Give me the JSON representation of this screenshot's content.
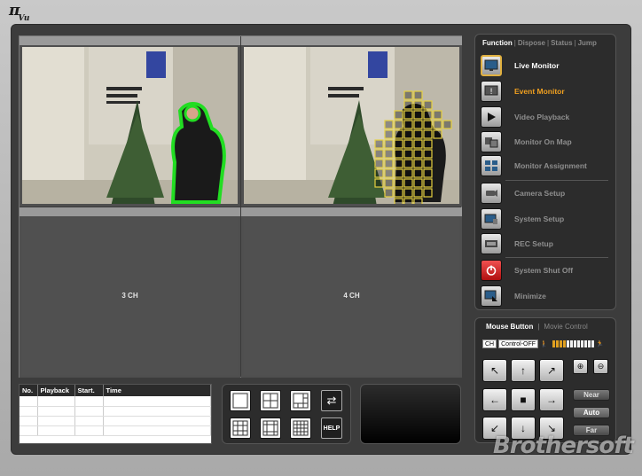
{
  "app": {
    "logo_text": "π",
    "logo_sub": "Vu"
  },
  "channels": [
    {
      "id": 1,
      "label": "",
      "has_feed": true
    },
    {
      "id": 2,
      "label": "",
      "has_feed": true
    },
    {
      "id": 3,
      "label": "3 CH",
      "has_feed": false
    },
    {
      "id": 4,
      "label": "4 CH",
      "has_feed": false
    }
  ],
  "function_panel": {
    "tabs": [
      "Function",
      "Dispose",
      "Status",
      "Jump"
    ],
    "active_tab": "Function",
    "items": [
      {
        "label": "Live Monitor",
        "icon": "monitor-icon",
        "state": "active"
      },
      {
        "label": "Event Monitor",
        "icon": "alert-monitor-icon",
        "state": "highlight"
      },
      {
        "label": "Video Playback",
        "icon": "play-icon",
        "state": "normal"
      },
      {
        "label": "Monitor On Map",
        "icon": "map-icon",
        "state": "normal"
      },
      {
        "label": "Monitor Assignment",
        "icon": "assignment-icon",
        "state": "normal"
      },
      {
        "label": "Camera Setup",
        "icon": "camera-icon",
        "state": "normal"
      },
      {
        "label": "System Setup",
        "icon": "system-icon",
        "state": "normal"
      },
      {
        "label": "REC Setup",
        "icon": "film-icon",
        "state": "normal"
      },
      {
        "label": "System Shut Off",
        "icon": "power-icon",
        "state": "normal"
      },
      {
        "label": "Minimize",
        "icon": "minimize-icon",
        "state": "normal"
      }
    ]
  },
  "mouse_panel": {
    "tabs": [
      "Mouse Button",
      "Movie Control"
    ],
    "active_tab": "Mouse Button",
    "ch_field": "CH",
    "control_field": "Control-OFF",
    "speed_level": 0.3,
    "near_label": "Near",
    "auto_label": "Auto",
    "far_label": "Far"
  },
  "log_table": {
    "columns": [
      "No.",
      "Playback",
      "Start.",
      "Time"
    ],
    "rows": []
  },
  "layout_panel": {
    "help_label": "HELP"
  },
  "watermark": "Brothersoft",
  "colors": {
    "accent_orange": "#f0a020",
    "motion_green": "#22dd22",
    "motion_yellow": "#e6d040"
  }
}
